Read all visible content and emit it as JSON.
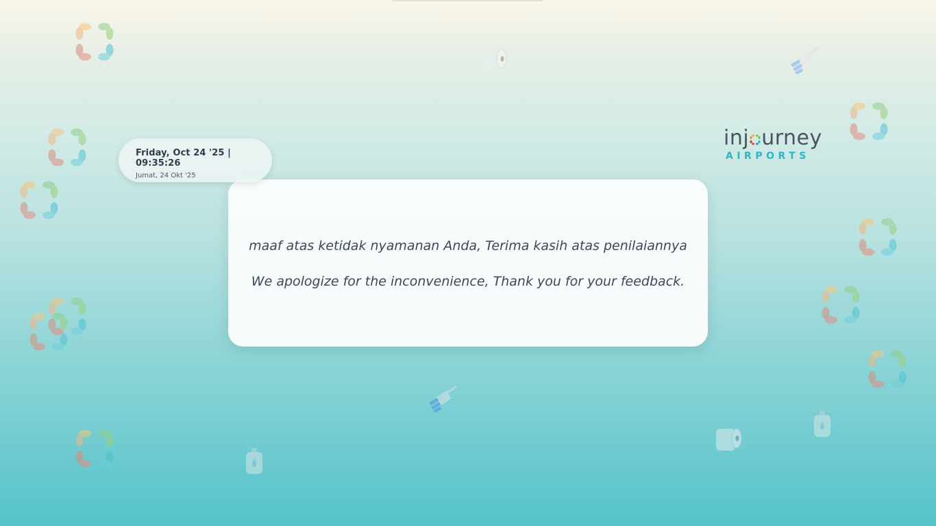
{
  "datetime": {
    "primary": "Friday, Oct 24 '25 | 09:35:26",
    "secondary": "Jumat, 24 Okt '25"
  },
  "message": {
    "indonesian": "maaf atas ketidak nyamanan Anda, Terima kasih atas penilaiannya",
    "english": "We apologize for the inconvenience, Thank you for your feedback."
  },
  "logo": {
    "word_before": "inj",
    "word_after": "urney",
    "subtitle": "AIRPORTS"
  },
  "decorations": {
    "ring_icon": "leaf-ring-icon",
    "toilet_paper_icon": "toilet-paper-icon",
    "brush_icon": "cleaning-brush-icon",
    "soap_icon": "soap-bottle-icon"
  },
  "colors": {
    "accent": "#29b6c6",
    "text": "#3b4758"
  }
}
